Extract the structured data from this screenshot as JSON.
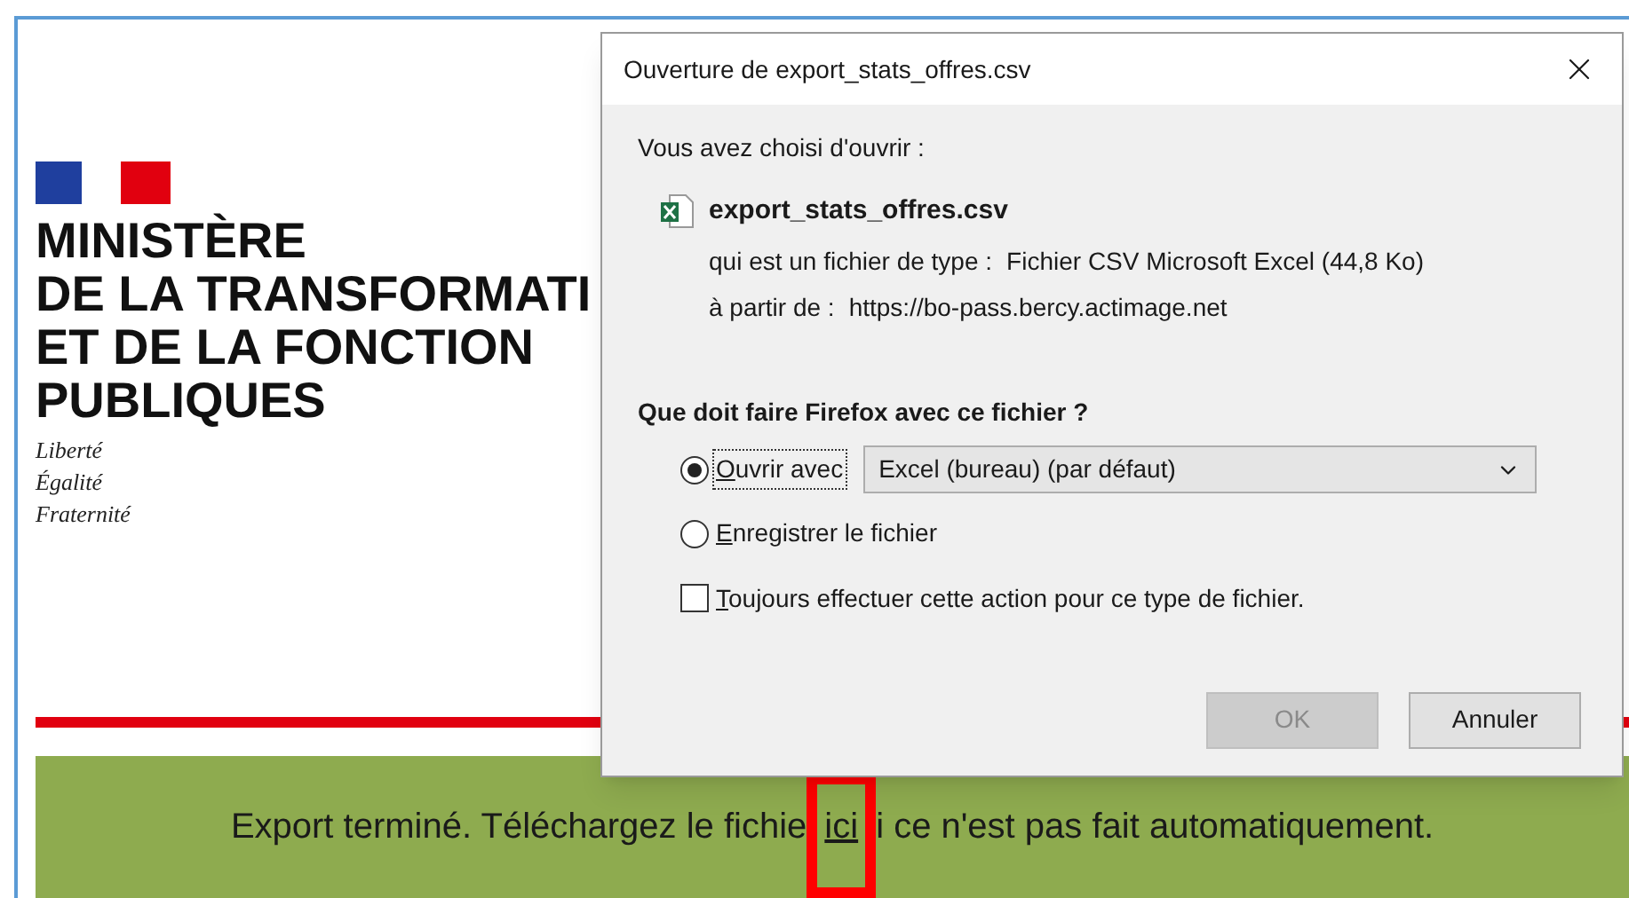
{
  "page": {
    "title_lines": [
      "MINISTÈRE",
      "DE LA TRANSFORMATI",
      "ET DE LA FONCTION",
      "PUBLIQUES"
    ],
    "motto": [
      "Liberté",
      "Égalité",
      "Fraternité"
    ],
    "banner": {
      "before": "Export terminé. Téléchargez le fichie",
      "link": "ici",
      "after": "i ce n'est pas fait automatiquement."
    }
  },
  "dialog": {
    "title": "Ouverture de export_stats_offres.csv",
    "intro": "Vous avez choisi d'ouvrir :",
    "file_name": "export_stats_offres.csv",
    "details": [
      {
        "label": "qui est un fichier de type :",
        "value": "Fichier CSV Microsoft Excel (44,8 Ko)"
      },
      {
        "label": "à partir de :",
        "value": "https://bo-pass.bercy.actimage.net"
      }
    ],
    "question": "Que doit faire Firefox avec ce fichier ?",
    "options": [
      {
        "label": "Ouvrir avec",
        "selected": true,
        "focused": true,
        "app": "Excel (bureau) (par défaut)"
      },
      {
        "label": "Enregistrer le fichier",
        "selected": false,
        "focused": false
      }
    ],
    "always": {
      "label": "Toujours effectuer cette action pour ce type de fichier.",
      "checked": false
    },
    "buttons": [
      {
        "label": "OK",
        "disabled": true
      },
      {
        "label": "Annuler",
        "disabled": false
      }
    ]
  }
}
